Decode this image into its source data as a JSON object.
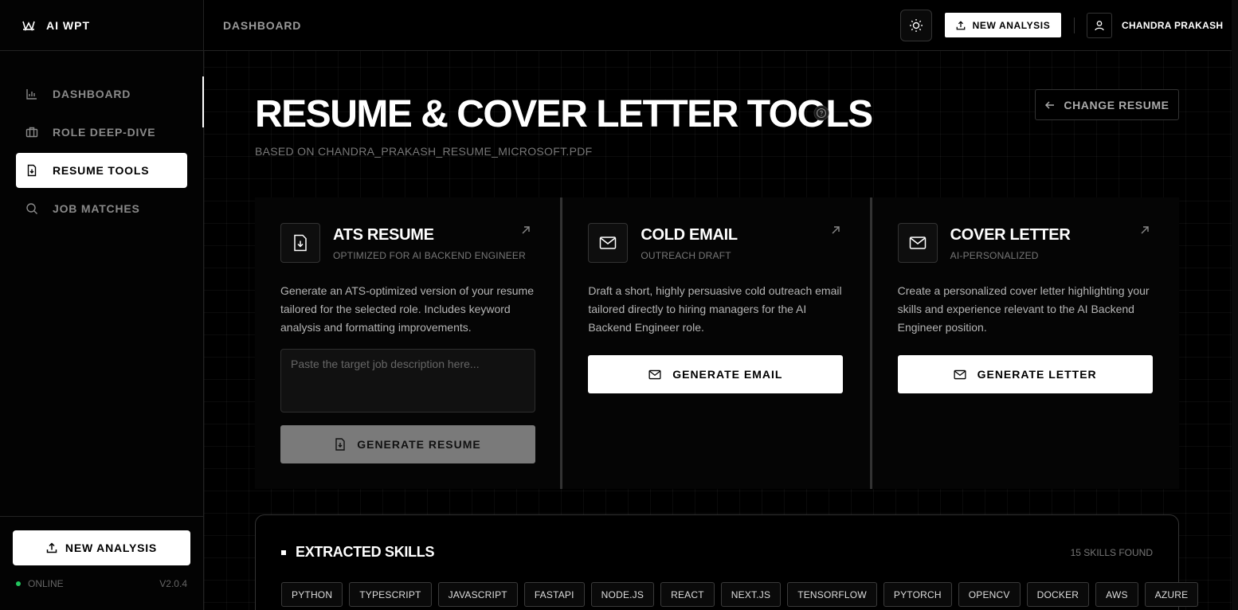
{
  "app": {
    "brand": "AI WPT"
  },
  "sidebar": {
    "items": [
      {
        "label": "DASHBOARD",
        "icon": "bar-chart-icon",
        "active": false
      },
      {
        "label": "ROLE DEEP-DIVE",
        "icon": "briefcase-icon",
        "active": false
      },
      {
        "label": "RESUME TOOLS",
        "icon": "file-download-icon",
        "active": true
      },
      {
        "label": "JOB MATCHES",
        "icon": "search-icon",
        "active": false
      }
    ],
    "new_analysis_label": "NEW ANALYSIS",
    "status": "ONLINE",
    "version": "V2.0.4"
  },
  "topbar": {
    "title": "DASHBOARD",
    "new_analysis_label": "NEW ANALYSIS",
    "user_name": "CHANDRA PRAKASH"
  },
  "page": {
    "title": "RESUME & COVER LETTER TOOLS",
    "subtitle": "BASED ON CHANDRA_PRAKASH_RESUME_MICROSOFT.PDF",
    "change_resume_label": "CHANGE RESUME"
  },
  "cards": [
    {
      "title": "ATS RESUME",
      "subtitle": "OPTIMIZED FOR AI BACKEND ENGINEER",
      "description": "Generate an ATS-optimized version of your resume tailored for the selected role. Includes keyword analysis and formatting improvements.",
      "input_placeholder": "Paste the target job description here...",
      "button_label": "GENERATE RESUME"
    },
    {
      "title": "COLD EMAIL",
      "subtitle": "OUTREACH DRAFT",
      "description": "Draft a short, highly persuasive cold outreach email tailored directly to hiring managers for the AI Backend Engineer role.",
      "button_label": "GENERATE EMAIL"
    },
    {
      "title": "COVER LETTER",
      "subtitle": "AI-PERSONALIZED",
      "description": "Create a personalized cover letter highlighting your skills and experience relevant to the AI Backend Engineer position.",
      "button_label": "GENERATE LETTER"
    }
  ],
  "skills": {
    "title": "EXTRACTED SKILLS",
    "count_label": "15 SKILLS FOUND",
    "items": [
      "PYTHON",
      "TYPESCRIPT",
      "JAVASCRIPT",
      "FASTAPI",
      "NODE.JS",
      "REACT",
      "NEXT.JS",
      "TENSORFLOW",
      "PYTORCH",
      "OPENCV",
      "DOCKER",
      "AWS",
      "AZURE"
    ]
  },
  "colors": {
    "background": "#000000",
    "accent": "#ffffff",
    "status_online": "#22c55e",
    "muted_text": "#777777"
  }
}
